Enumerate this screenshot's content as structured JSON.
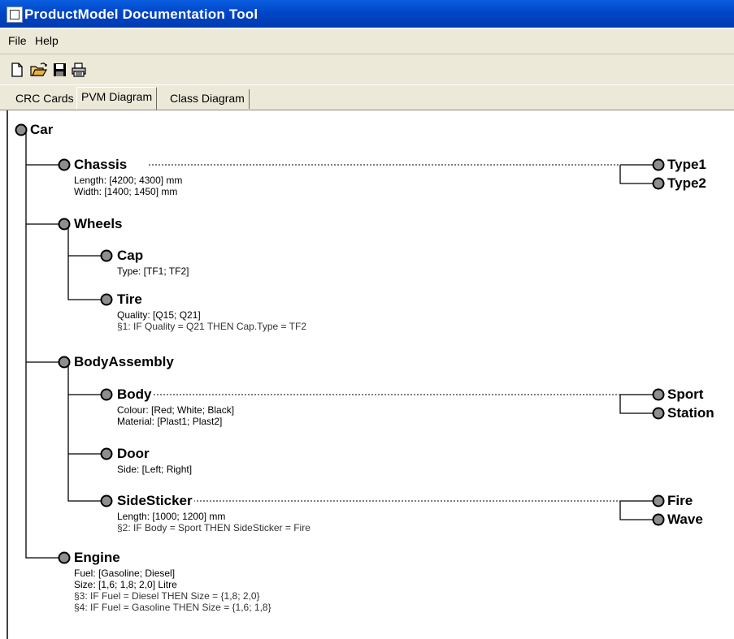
{
  "window": {
    "title": "ProductModel Documentation Tool"
  },
  "menu": {
    "file": "File",
    "help": "Help"
  },
  "toolbar": {
    "icons": [
      "new-icon",
      "open-icon",
      "save-icon",
      "print-icon"
    ]
  },
  "tabs": [
    {
      "label": "CRC Cards",
      "active": false
    },
    {
      "label": "PVM Diagram",
      "active": true
    },
    {
      "label": "Class Diagram",
      "active": false
    }
  ],
  "diagram": {
    "root": "Car",
    "chassis": {
      "name": "Chassis",
      "attrs": [
        "Length: [4200; 4300] mm",
        "Width: [1400; 1450] mm"
      ],
      "variants": [
        "Type1",
        "Type2"
      ]
    },
    "wheels": {
      "name": "Wheels"
    },
    "cap": {
      "name": "Cap",
      "attrs": [
        "Type: [TF1; TF2]"
      ]
    },
    "tire": {
      "name": "Tire",
      "attrs": [
        "Quality: [Q15; Q21]"
      ],
      "rules": [
        "§1: IF Quality = Q21 THEN Cap.Type = TF2"
      ]
    },
    "bodyassembly": {
      "name": "BodyAssembly"
    },
    "body": {
      "name": "Body",
      "attrs": [
        "Colour: [Red; White; Black]",
        "Material: [Plast1; Plast2]"
      ],
      "variants": [
        "Sport",
        "Station"
      ]
    },
    "door": {
      "name": "Door",
      "attrs": [
        "Side: [Left; Right]"
      ]
    },
    "sidesticker": {
      "name": "SideSticker",
      "attrs": [
        "Length: [1000; 1200] mm"
      ],
      "rules": [
        "§2: IF Body = Sport THEN SideSticker = Fire"
      ],
      "variants": [
        "Fire",
        "Wave"
      ]
    },
    "engine": {
      "name": "Engine",
      "attrs": [
        "Fuel: [Gasoline; Diesel]",
        "Size: [1,6; 1,8; 2,0] Litre"
      ],
      "rules": [
        "§3: IF Fuel = Diesel THEN Size = {1,8; 2,0}",
        "§4: IF Fuel = Gasoline THEN Size = {1,6; 1,8}"
      ]
    }
  }
}
